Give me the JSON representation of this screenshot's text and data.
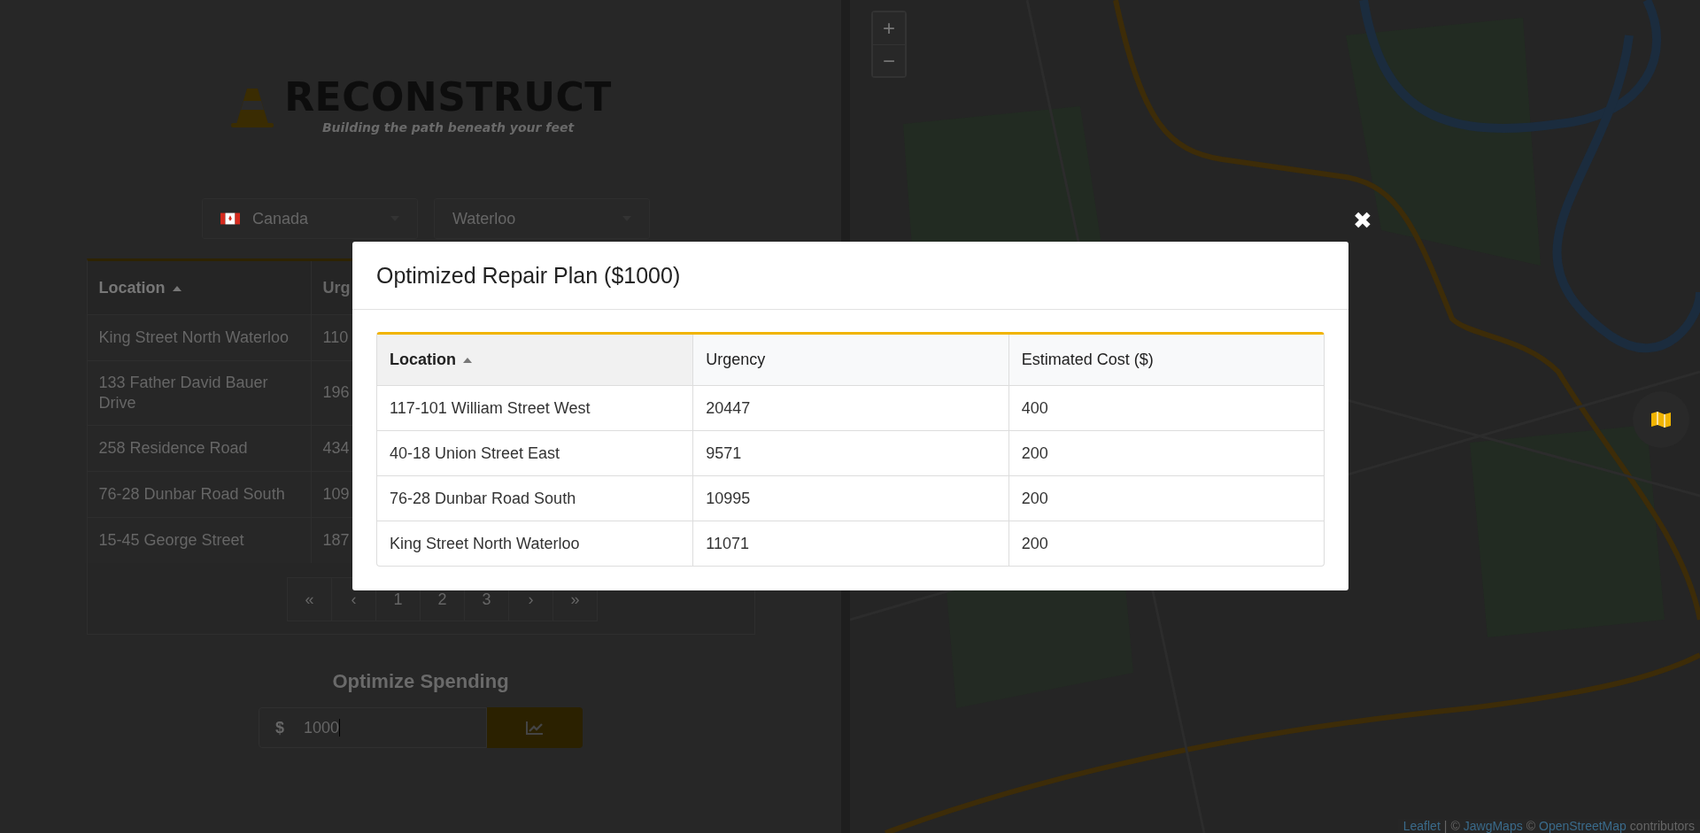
{
  "logo": {
    "title": "RECONSTRUCT",
    "tagline": "Building the path beneath your feet"
  },
  "filters": {
    "country": "Canada",
    "city": "Waterloo"
  },
  "table": {
    "columns": [
      {
        "label": "Location",
        "sorted": true
      },
      {
        "label": "Urg",
        "sorted": false
      }
    ],
    "rows": [
      [
        "King Street North Waterloo",
        "110"
      ],
      [
        "133 Father David Bauer Drive",
        "196"
      ],
      [
        "258 Residence Road",
        "434"
      ],
      [
        "76-28 Dunbar Road South",
        "109"
      ],
      [
        "15-45 George Street",
        "187"
      ]
    ]
  },
  "pagination": [
    "«",
    "‹",
    "1",
    "2",
    "3",
    "›",
    "»"
  ],
  "optimize": {
    "title": "Optimize Spending",
    "currency": "$",
    "value": "1000"
  },
  "map": {
    "zoom_in": "+",
    "zoom_out": "−",
    "attribution": [
      {
        "text": "Leaflet",
        "kind": "link"
      },
      {
        "text": "|",
        "kind": "text"
      },
      {
        "text": "©",
        "kind": "text"
      },
      {
        "text": "JawgMaps",
        "kind": "link"
      },
      {
        "text": "©",
        "kind": "text"
      },
      {
        "text": "OpenStreetMap",
        "kind": "link"
      },
      {
        "text": "contributors",
        "kind": "text"
      }
    ]
  },
  "modal": {
    "title": "Optimized Repair Plan ($1000)",
    "close": "✖",
    "columns": [
      {
        "label": "Location",
        "sorted": true
      },
      {
        "label": "Urgency",
        "sorted": false
      },
      {
        "label": "Estimated Cost ($)",
        "sorted": false
      }
    ],
    "rows": [
      [
        "117-101 William Street West",
        "20447",
        "400"
      ],
      [
        "40-18 Union Street East",
        "9571",
        "200"
      ],
      [
        "76-28 Dunbar Road South",
        "10995",
        "200"
      ],
      [
        "King Street North Waterloo",
        "11071",
        "200"
      ]
    ]
  }
}
